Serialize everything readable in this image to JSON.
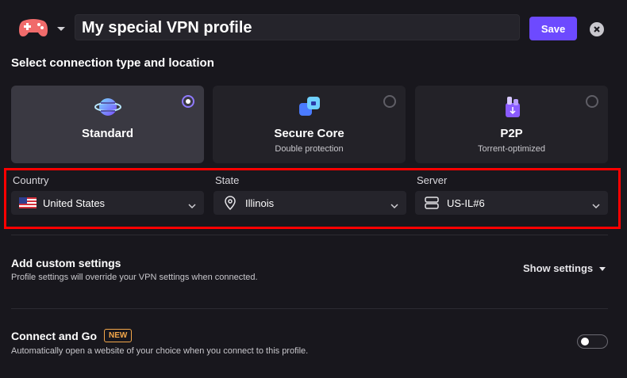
{
  "header": {
    "profile_name": "My special VPN profile",
    "save_label": "Save",
    "profile_icon": "gamepad-icon",
    "accent_color": "#6d4aff"
  },
  "connection": {
    "heading": "Select connection type and location",
    "types": [
      {
        "title": "Standard",
        "subtitle": "",
        "icon": "globe-icon",
        "selected": true
      },
      {
        "title": "Secure Core",
        "subtitle": "Double protection",
        "icon": "secure-core-icon",
        "selected": false
      },
      {
        "title": "P2P",
        "subtitle": "Torrent-optimized",
        "icon": "p2p-icon",
        "selected": false
      }
    ]
  },
  "location": {
    "country_label": "Country",
    "country_value": "United States",
    "state_label": "State",
    "state_value": "Illinois",
    "server_label": "Server",
    "server_value": "US-IL#6",
    "highlight_color": "#ff0000"
  },
  "custom_settings": {
    "title": "Add custom settings",
    "subtitle": "Profile settings will override your VPN settings when connected.",
    "show_label": "Show settings"
  },
  "connect_and_go": {
    "title": "Connect and Go",
    "badge": "NEW",
    "subtitle": "Automatically open a website of your choice when you connect to this profile.",
    "enabled": false
  }
}
